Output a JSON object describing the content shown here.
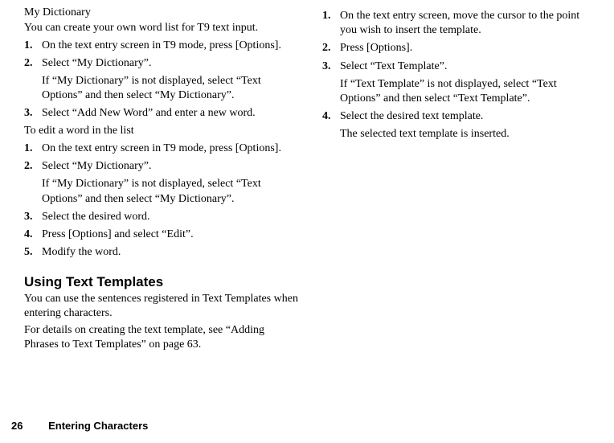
{
  "left": {
    "sub1": "My Dictionary",
    "intro1": "You can create your own word list for T9 text input.",
    "list1": [
      {
        "n": "1.",
        "t": "On the text entry screen in T9 mode, press [Options]."
      },
      {
        "n": "2.",
        "t": "Select “My Dictionary”.",
        "note": "If “My Dictionary” is not displayed, select “Text Options” and then select “My Dictionary”."
      },
      {
        "n": "3.",
        "t": "Select “Add New Word” and enter a new word."
      }
    ],
    "intro2": "To edit a word in the list",
    "list2": [
      {
        "n": "1.",
        "t": "On the text entry screen in T9 mode, press [Options]."
      },
      {
        "n": "2.",
        "t": "Select “My Dictionary”.",
        "note": "If “My Dictionary” is not displayed, select “Text Options” and then select “My Dictionary”."
      },
      {
        "n": "3.",
        "t": "Select the desired word."
      },
      {
        "n": "4.",
        "t": "Press [Options] and select “Edit”."
      },
      {
        "n": "5.",
        "t": "Modify the word."
      }
    ],
    "heading2": "Using Text Templates",
    "intro3": "You can use the sentences registered in Text Templates when entering characters.",
    "intro4": "For details on creating the text template, see “Adding Phrases to Text Templates” on page 63."
  },
  "right": {
    "list1": [
      {
        "n": "1.",
        "t": "On the text entry screen, move the cursor to the point you wish to insert the template."
      },
      {
        "n": "2.",
        "t": "Press [Options]."
      },
      {
        "n": "3.",
        "t": "Select “Text Template”.",
        "note": "If “Text Template” is not displayed, select “Text Options” and then select “Text Template”."
      },
      {
        "n": "4.",
        "t": "Select the desired text template.",
        "note": "The selected text template is inserted."
      }
    ]
  },
  "footer": {
    "page": "26",
    "section": "Entering Characters"
  }
}
